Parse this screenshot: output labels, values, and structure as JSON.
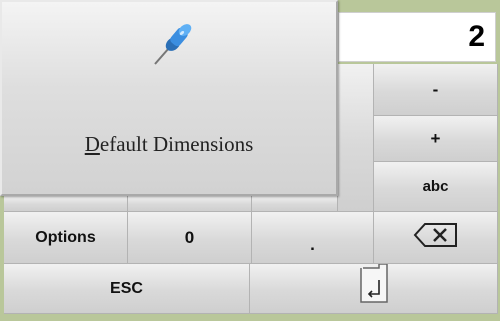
{
  "display": {
    "value": "2"
  },
  "popup": {
    "label_first": "D",
    "label_rest": "efault Dimensions",
    "icon": "pushpin-icon"
  },
  "keys": {
    "minus": "-",
    "plus": "+",
    "abc": "abc",
    "options": "Options",
    "zero": "0",
    "dot": ".",
    "esc": "ESC"
  },
  "icons": {
    "backspace": "backspace-icon",
    "enter": "enter-icon"
  }
}
